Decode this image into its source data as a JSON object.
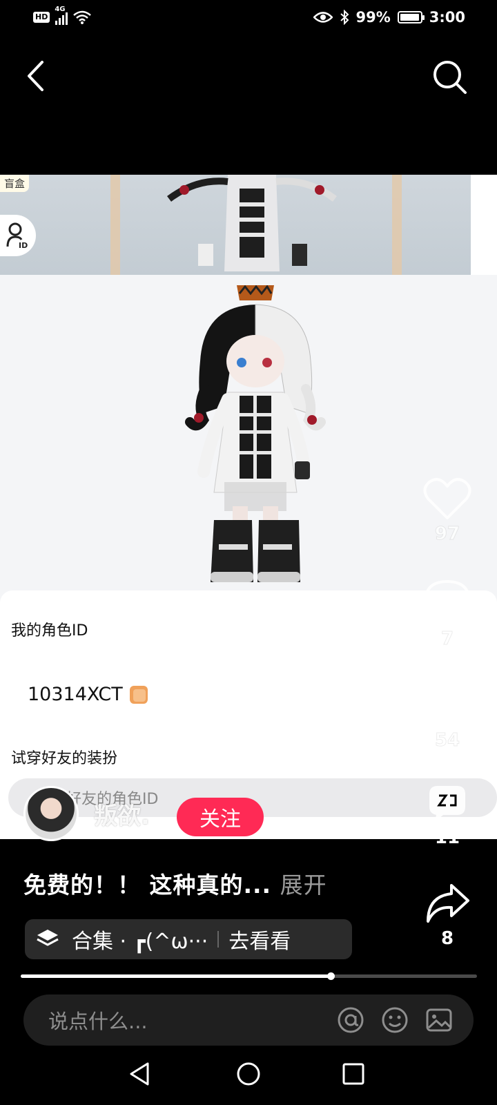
{
  "status_bar": {
    "hd_badge": "HD",
    "network": "4G",
    "battery_percent": "99%",
    "battery_level": 0.99,
    "time": "3:00"
  },
  "video": {
    "blind_box_label": "盲盒",
    "panel": {
      "title": "我的角色ID",
      "id_value": "10314XCT",
      "tryon_title": "试穿好友的装扮",
      "tryon_placeholder": "输入好友的角色ID"
    }
  },
  "actions": {
    "like_count": "97",
    "comment_count": "7",
    "favorite_count": "54",
    "share_count": "11",
    "forward_count": "8"
  },
  "author": {
    "name": "叛欲.",
    "follow_label": "关注"
  },
  "caption": {
    "text": "免费的！！ 这种真的...",
    "expand_label": "展开"
  },
  "collection": {
    "label": "合集 · ┏(^ω···",
    "go_label": "去看看"
  },
  "playback": {
    "progress": 0.68
  },
  "comment_bar": {
    "placeholder": "说点什么..."
  },
  "icons": [
    "back-icon",
    "search-icon",
    "heart-icon",
    "comment-icon",
    "star-icon",
    "share-icon",
    "forward-icon",
    "layers-icon",
    "at-icon",
    "emoji-icon",
    "image-icon",
    "nav-back-icon",
    "nav-home-icon",
    "nav-recents-icon"
  ],
  "colors": {
    "accent": "#ff2a55",
    "background": "#000000"
  }
}
